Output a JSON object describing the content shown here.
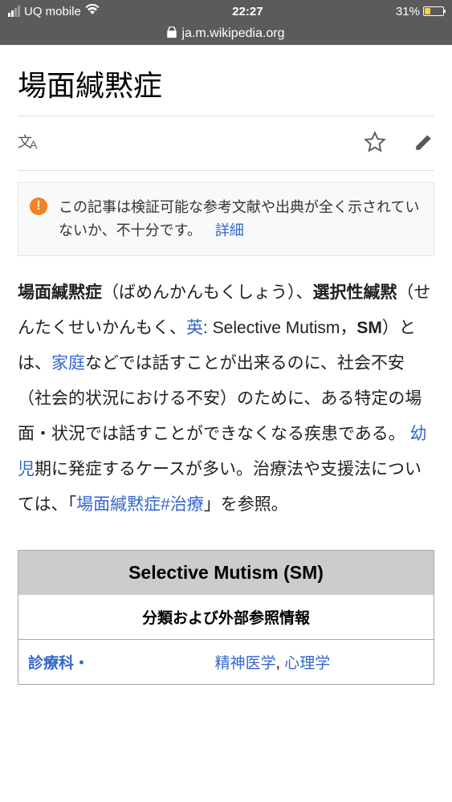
{
  "status": {
    "carrier": "UQ mobile",
    "time": "22:27",
    "battery_pct": "31%"
  },
  "url": "ja.m.wikipedia.org",
  "page": {
    "title": "場面緘黙症"
  },
  "notice": {
    "text": "この記事は検証可能な参考文献や出典が全く示されていないか、不十分です。",
    "details_label": "詳細"
  },
  "body": {
    "term1": "場面緘黙症",
    "reading1": "（ばめんかんもくしょう）、",
    "term2": "選択性緘黙",
    "reading2": "（せんたくせいかんもく、",
    "lang_link": "英",
    "colon": ": Selective Mutism，",
    "abbr": "SM",
    "paren_close": "）とは、",
    "family_link": "家庭",
    "seg1": "などでは話すことが出来るのに、社会不安（社会的状況における不安）のために、ある特定の場面・状況では話すことができなくなる疾患である。 ",
    "infant_link": "幼児",
    "seg2": "期に発症するケースが多い。治療法や支援法については、「",
    "treat_link": "場面緘黙症#治療",
    "seg3": "」を参照。"
  },
  "infobox": {
    "title": "Selective Mutism (SM)",
    "subtitle": "分類および外部参照情報",
    "row1_label": "診療科・",
    "row1_val1": "精神医学",
    "row1_sep": ", ",
    "row1_val2": "心理学"
  }
}
